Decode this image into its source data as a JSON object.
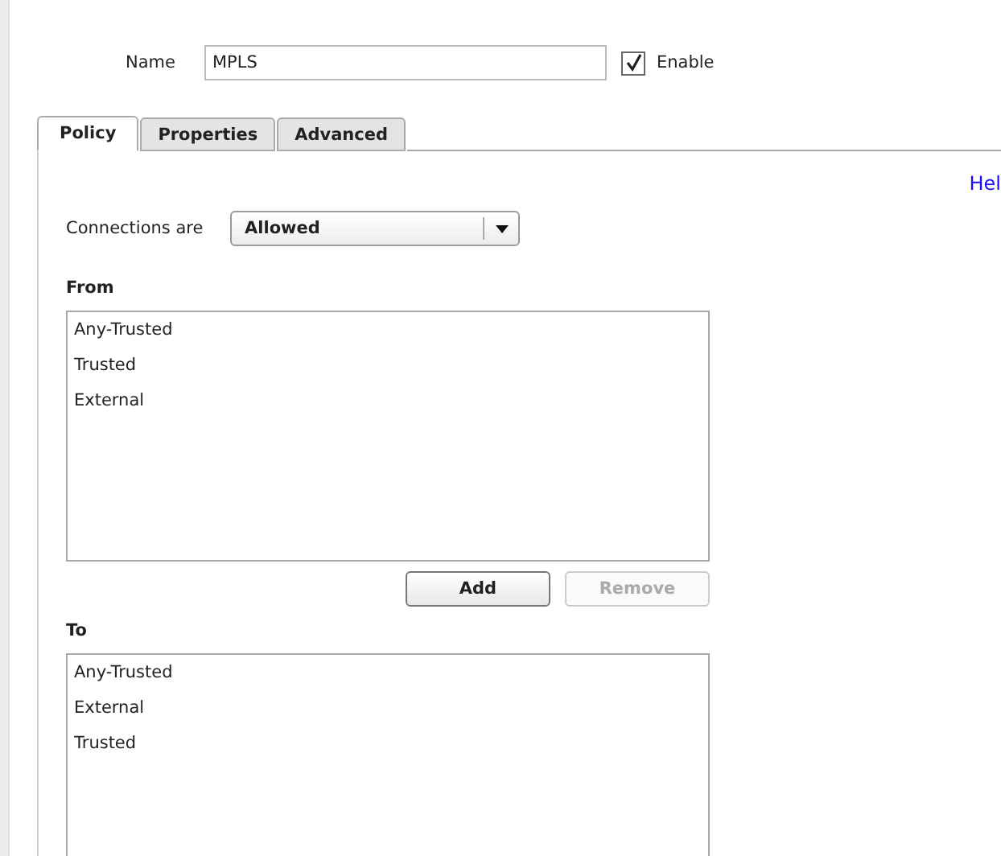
{
  "name_field": {
    "label": "Name",
    "value": "MPLS"
  },
  "enable": {
    "label": "Enable",
    "checked": true
  },
  "tabs": [
    {
      "label": "Policy",
      "selected": true
    },
    {
      "label": "Properties",
      "selected": false
    },
    {
      "label": "Advanced",
      "selected": false
    }
  ],
  "help_link": "Hel",
  "connections": {
    "label": "Connections are",
    "value": "Allowed"
  },
  "from": {
    "label": "From",
    "items": [
      "Any-Trusted",
      "Trusted",
      "External"
    ]
  },
  "buttons": [
    {
      "label": "Add",
      "disabled": false
    },
    {
      "label": "Remove",
      "disabled": true
    }
  ],
  "to": {
    "label": "To",
    "items": [
      "Any-Trusted",
      "External",
      "Trusted"
    ]
  }
}
